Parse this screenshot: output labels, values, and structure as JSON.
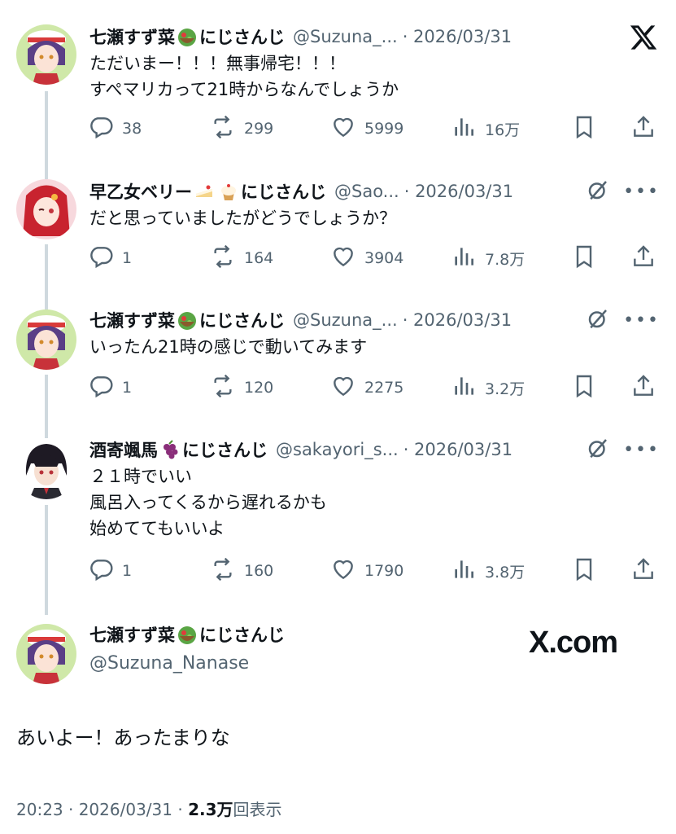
{
  "tweets": [
    {
      "name": "七瀬すず菜",
      "suffix": "にじさんじ",
      "handle": "@Suzuna_...",
      "date": "· 2026/03/31",
      "lines": "ただいまー！！！無事帰宅！！！\nすぺマリカって21時からなんでしょうか",
      "reply": "38",
      "retweet": "299",
      "like": "5999",
      "views": "16万"
    },
    {
      "name": "早乙女ベリー",
      "suffix": "にじさんじ",
      "handle": "@Sao...",
      "date": "· 2026/03/31",
      "lines": "だと思っていましたがどうでしょうか？",
      "reply": "1",
      "retweet": "164",
      "like": "3904",
      "views": "7.8万"
    },
    {
      "name": "七瀬すず菜",
      "suffix": "にじさんじ",
      "handle": "@Suzuna_...",
      "date": "· 2026/03/31",
      "lines": "いったん21時の感じで動いてみます",
      "reply": "1",
      "retweet": "120",
      "like": "2275",
      "views": "3.2万"
    },
    {
      "name": "酒寄颯馬",
      "suffix": "にじさんじ",
      "handle": "@sakayori_s...",
      "date": "· 2026/03/31",
      "lines": "２１時でいい\n風呂入ってくるから遅れるかも\n始めててもいいよ",
      "reply": "1",
      "retweet": "160",
      "like": "1790",
      "views": "3.8万"
    }
  ],
  "main": {
    "name": "七瀬すず菜",
    "suffix": "にじさんじ",
    "handle": "@Suzuna_Nanase",
    "brand": "X.com",
    "text": "あいよー！あったまりな",
    "time": "20:23 · 2026/03/31 · ",
    "views_count": "2.3万",
    "views_label": "回表示"
  },
  "colors": {
    "text": "#0f1419",
    "secondary": "#536471",
    "thread_line": "#cfd9de"
  },
  "icons": [
    "x-logo-icon",
    "grok-icon",
    "more-icon",
    "reply-icon",
    "retweet-icon",
    "like-icon",
    "views-icon",
    "bookmark-icon",
    "share-icon"
  ]
}
